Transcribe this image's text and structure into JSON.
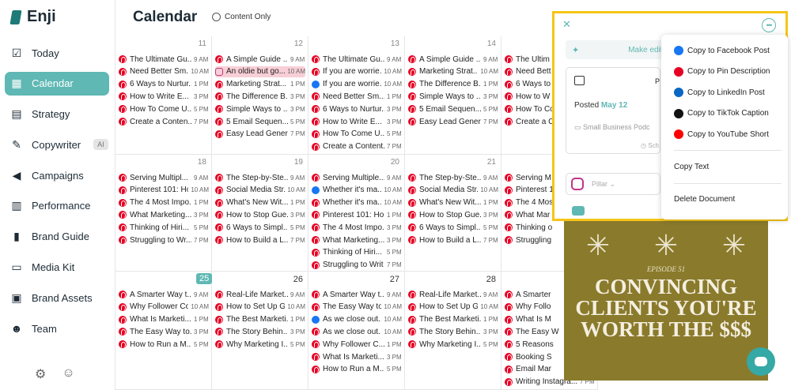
{
  "app": {
    "name": "Enji"
  },
  "sidebar": {
    "items": [
      {
        "label": "Today",
        "icon": "checklist-icon"
      },
      {
        "label": "Calendar",
        "icon": "calendar-icon",
        "active": true
      },
      {
        "label": "Strategy",
        "icon": "clipboard-icon"
      },
      {
        "label": "Copywriter",
        "icon": "pen-icon",
        "badge": "AI"
      },
      {
        "label": "Campaigns",
        "icon": "megaphone-icon"
      },
      {
        "label": "Performance",
        "icon": "chart-icon"
      },
      {
        "label": "Brand Guide",
        "icon": "book-icon"
      },
      {
        "label": "Media Kit",
        "icon": "briefcase-icon"
      },
      {
        "label": "Brand Assets",
        "icon": "image-icon"
      },
      {
        "label": "Team",
        "icon": "team-icon"
      }
    ]
  },
  "header": {
    "title": "Calendar",
    "filter_label": "Content Only"
  },
  "calendar": {
    "weeks": [
      {
        "days": [
          {
            "num": "11",
            "posts": [
              {
                "icon": "pin",
                "text": "The Ultimate Gu...",
                "time": "9 AM"
              },
              {
                "icon": "pin",
                "text": "Need Better Sm...",
                "time": "10 AM"
              },
              {
                "icon": "pin",
                "text": "6 Ways to Nurtur...",
                "time": "1 PM"
              },
              {
                "icon": "pin",
                "text": "How to Write E...",
                "time": "3 PM"
              },
              {
                "icon": "pin",
                "text": "How To Come U...",
                "time": "5 PM"
              },
              {
                "icon": "pin",
                "text": "Create a Conten...",
                "time": "7 PM"
              }
            ]
          },
          {
            "num": "12",
            "posts": [
              {
                "icon": "pin",
                "text": "A Simple Guide ...",
                "time": "9 AM"
              },
              {
                "icon": "ig",
                "text": "An oldie but go...",
                "time": "10 AM",
                "highlight": true
              },
              {
                "icon": "pin",
                "text": "Marketing Strat...",
                "time": "1 PM"
              },
              {
                "icon": "pin",
                "text": "The Difference B...",
                "time": "3 PM"
              },
              {
                "icon": "pin",
                "text": "Simple Ways to ...",
                "time": "3 PM"
              },
              {
                "icon": "pin",
                "text": "5 Email Sequen...",
                "time": "5 PM"
              },
              {
                "icon": "pin",
                "text": "Easy Lead Gener...",
                "time": "7 PM"
              }
            ]
          },
          {
            "num": "13",
            "posts": [
              {
                "icon": "pin",
                "text": "The Ultimate Gu...",
                "time": "9 AM"
              },
              {
                "icon": "pin",
                "text": "If you are worrie...",
                "time": "10 AM"
              },
              {
                "icon": "fb",
                "text": "If you are worrie...",
                "time": "10 AM"
              },
              {
                "icon": "pin",
                "text": "Need Better Sm...",
                "time": "1 PM"
              },
              {
                "icon": "pin",
                "text": "6 Ways to Nurtur...",
                "time": "3 PM"
              },
              {
                "icon": "pin",
                "text": "How to Write E...",
                "time": "3 PM"
              },
              {
                "icon": "pin",
                "text": "How To Come U...",
                "time": "5 PM"
              },
              {
                "icon": "pin",
                "text": "Create a Content...",
                "time": "7 PM"
              }
            ]
          },
          {
            "num": "14",
            "posts": [
              {
                "icon": "pin",
                "text": "A Simple Guide ...",
                "time": "9 AM"
              },
              {
                "icon": "pin",
                "text": "Marketing Strat...",
                "time": "10 AM"
              },
              {
                "icon": "pin",
                "text": "The Difference B...",
                "time": "1 PM"
              },
              {
                "icon": "pin",
                "text": "Simple Ways to ...",
                "time": "3 PM"
              },
              {
                "icon": "pin",
                "text": "5 Email Sequen...",
                "time": "5 PM"
              },
              {
                "icon": "pin",
                "text": "Easy Lead Gener...",
                "time": "7 PM"
              }
            ]
          },
          {
            "num": "",
            "posts": [
              {
                "icon": "pin",
                "text": "The Ultim",
                "time": ""
              },
              {
                "icon": "pin",
                "text": "Need Bett",
                "time": ""
              },
              {
                "icon": "pin",
                "text": "6 Ways to",
                "time": ""
              },
              {
                "icon": "pin",
                "text": "How to W",
                "time": ""
              },
              {
                "icon": "pin",
                "text": "How To Co",
                "time": ""
              },
              {
                "icon": "pin",
                "text": "Create a C",
                "time": ""
              }
            ]
          }
        ]
      },
      {
        "days": [
          {
            "num": "18",
            "posts": [
              {
                "icon": "pin",
                "text": "Serving Multipl...",
                "time": "9 AM"
              },
              {
                "icon": "pin",
                "text": "Pinterest 101: Ho...",
                "time": "10 AM"
              },
              {
                "icon": "pin",
                "text": "The 4 Most Impo...",
                "time": "1 PM"
              },
              {
                "icon": "pin",
                "text": "What Marketing...",
                "time": "3 PM"
              },
              {
                "icon": "pin",
                "text": "Thinking of Hiri...",
                "time": "5 PM"
              },
              {
                "icon": "pin",
                "text": "Struggling to Wr...",
                "time": "7 PM"
              }
            ]
          },
          {
            "num": "19",
            "posts": [
              {
                "icon": "pin",
                "text": "The Step-by-Ste...",
                "time": "9 AM"
              },
              {
                "icon": "pin",
                "text": "Social Media Str...",
                "time": "10 AM"
              },
              {
                "icon": "pin",
                "text": "What's New Wit...",
                "time": "1 PM"
              },
              {
                "icon": "pin",
                "text": "How to Stop Gue...",
                "time": "3 PM"
              },
              {
                "icon": "pin",
                "text": "6 Ways to Simpl...",
                "time": "5 PM"
              },
              {
                "icon": "pin",
                "text": "How to Build a L...",
                "time": "7 PM"
              }
            ]
          },
          {
            "num": "20",
            "posts": [
              {
                "icon": "pin",
                "text": "Serving Multiple...",
                "time": "9 AM"
              },
              {
                "icon": "fb",
                "text": "Whether it's ma...",
                "time": "10 AM"
              },
              {
                "icon": "pin",
                "text": "Whether it's ma...",
                "time": "10 AM"
              },
              {
                "icon": "pin",
                "text": "Pinterest 101: Ho...",
                "time": "1 PM"
              },
              {
                "icon": "pin",
                "text": "The 4 Most Impo...",
                "time": "3 PM"
              },
              {
                "icon": "pin",
                "text": "What Marketing...",
                "time": "3 PM"
              },
              {
                "icon": "pin",
                "text": "Thinking of Hiri...",
                "time": "5 PM"
              },
              {
                "icon": "pin",
                "text": "Struggling to Writ",
                "time": "7 PM"
              }
            ]
          },
          {
            "num": "21",
            "posts": [
              {
                "icon": "pin",
                "text": "The Step-by-Ste...",
                "time": "9 AM"
              },
              {
                "icon": "pin",
                "text": "Social Media Str...",
                "time": "10 AM"
              },
              {
                "icon": "pin",
                "text": "What's New Wit...",
                "time": "1 PM"
              },
              {
                "icon": "pin",
                "text": "How to Stop Gue...",
                "time": "3 PM"
              },
              {
                "icon": "pin",
                "text": "6 Ways to Simpl...",
                "time": "5 PM"
              },
              {
                "icon": "pin",
                "text": "How to Build a L...",
                "time": "7 PM"
              }
            ]
          },
          {
            "num": "",
            "posts": [
              {
                "icon": "pin",
                "text": "Serving M",
                "time": ""
              },
              {
                "icon": "pin",
                "text": "Pinterest 1",
                "time": ""
              },
              {
                "icon": "pin",
                "text": "The 4 Mos",
                "time": ""
              },
              {
                "icon": "pin",
                "text": "What Mar",
                "time": ""
              },
              {
                "icon": "pin",
                "text": "Thinking o",
                "time": ""
              },
              {
                "icon": "pin",
                "text": "Struggling",
                "time": ""
              }
            ]
          }
        ]
      },
      {
        "days": [
          {
            "num": "25",
            "today": true,
            "posts": [
              {
                "icon": "pin",
                "text": "A Smarter Way t...",
                "time": "9 AM"
              },
              {
                "icon": "pin",
                "text": "Why Follower Co...",
                "time": "10 AM"
              },
              {
                "icon": "pin",
                "text": "What Is Marketi...",
                "time": "1 PM"
              },
              {
                "icon": "pin",
                "text": "The Easy Way to...",
                "time": "3 PM"
              },
              {
                "icon": "pin",
                "text": "How to Run a M...",
                "time": "5 PM"
              }
            ]
          },
          {
            "num": "26",
            "posts": [
              {
                "icon": "pin",
                "text": "Real-Life Market...",
                "time": "9 AM"
              },
              {
                "icon": "pin",
                "text": "How to Set Up G...",
                "time": "10 AM"
              },
              {
                "icon": "pin",
                "text": "The Best Marketi...",
                "time": "1 PM"
              },
              {
                "icon": "pin",
                "text": "The Story Behin...",
                "time": "3 PM"
              },
              {
                "icon": "pin",
                "text": "Why Marketing I...",
                "time": "5 PM"
              }
            ]
          },
          {
            "num": "27",
            "posts": [
              {
                "icon": "pin",
                "text": "A Smarter Way t...",
                "time": "9 AM"
              },
              {
                "icon": "pin",
                "text": "The Easy Way to...",
                "time": "10 AM"
              },
              {
                "icon": "fb",
                "text": "As we close out...",
                "time": "10 AM"
              },
              {
                "icon": "pin",
                "text": "As we close out...",
                "time": "10 AM"
              },
              {
                "icon": "pin",
                "text": "Why Follower C...",
                "time": "1 PM"
              },
              {
                "icon": "pin",
                "text": "What Is Marketi...",
                "time": "3 PM"
              },
              {
                "icon": "pin",
                "text": "How to Run a M...",
                "time": "5 PM"
              }
            ]
          },
          {
            "num": "28",
            "posts": [
              {
                "icon": "pin",
                "text": "Real-Life Market...",
                "time": "9 AM"
              },
              {
                "icon": "pin",
                "text": "How to Set Up G...",
                "time": "10 AM"
              },
              {
                "icon": "pin",
                "text": "The Best Marketi...",
                "time": "1 PM"
              },
              {
                "icon": "pin",
                "text": "The Story Behin...",
                "time": "3 PM"
              },
              {
                "icon": "pin",
                "text": "Why Marketing I...",
                "time": "5 PM"
              }
            ]
          },
          {
            "num": "",
            "posts": [
              {
                "icon": "pin",
                "text": "A Smarter",
                "time": ""
              },
              {
                "icon": "pin",
                "text": "Why Follo",
                "time": ""
              },
              {
                "icon": "pin",
                "text": "What Is M",
                "time": ""
              },
              {
                "icon": "pin",
                "text": "The Easy W",
                "time": ""
              },
              {
                "icon": "pin",
                "text": "5 Reasons",
                "time": ""
              },
              {
                "icon": "pin",
                "text": "Booking S",
                "time": ""
              },
              {
                "icon": "pin",
                "text": "Email Mar",
                "time": ""
              },
              {
                "icon": "pin",
                "text": "Writing Instagra...",
                "time": "7 PM"
              }
            ]
          }
        ]
      }
    ]
  },
  "detail_panel": {
    "make_edit_label": "Make edit",
    "posted_label": "Posted",
    "posted_date": "May 12",
    "source": "Small Business Podc",
    "schedule_label": "Sch",
    "pillar_placeholder": "Pillar",
    "card_header_fragment": "P"
  },
  "dropdown_menu": {
    "items": [
      {
        "label": "Copy to Facebook Post",
        "icon": "facebook-icon",
        "color": "#1877f2"
      },
      {
        "label": "Copy to Pin Description",
        "icon": "pinterest-icon",
        "color": "#e60023"
      },
      {
        "label": "Copy to LinkedIn Post",
        "icon": "linkedin-icon",
        "color": "#0a66c2"
      },
      {
        "label": "Copy to TikTok Caption",
        "icon": "tiktok-icon",
        "color": "#111111"
      },
      {
        "label": "Copy to YouTube Short",
        "icon": "youtube-icon",
        "color": "#ff0000"
      }
    ],
    "copy_text_label": "Copy Text",
    "delete_label": "Delete Document"
  },
  "artwork": {
    "episode": "EPISODE 51",
    "title": "CONVINCING CLIENTS YOU'RE WORTH THE $$$"
  },
  "colors": {
    "accent": "#5fb8b4",
    "highlight_border": "#f5c518",
    "pinterest": "#e60023"
  }
}
